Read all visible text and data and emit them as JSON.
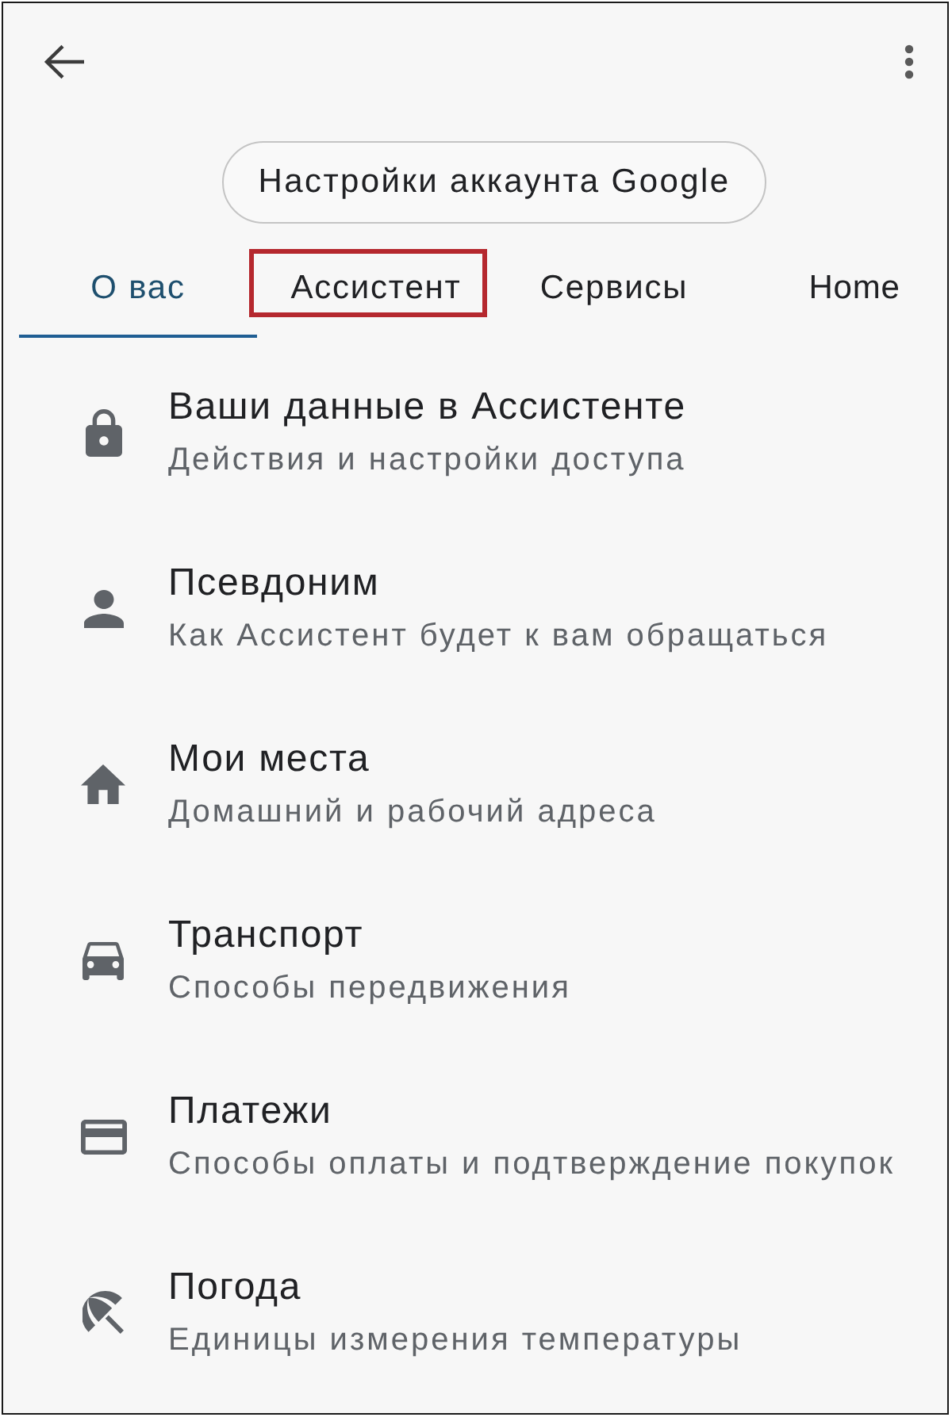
{
  "account_button": {
    "label": "Настройки аккаунта Google"
  },
  "tabs": [
    {
      "label": "О вас",
      "selected": true,
      "highlighted": false
    },
    {
      "label": "Ассистент",
      "selected": false,
      "highlighted": true
    },
    {
      "label": "Сервисы",
      "selected": false,
      "highlighted": false
    },
    {
      "label": "Home",
      "selected": false,
      "highlighted": false
    }
  ],
  "items": [
    {
      "title": "Ваши данные в Ассистенте",
      "subtitle": "Действия и настройки доступа"
    },
    {
      "title": "Псевдоним",
      "subtitle": "Как Ассистент будет к вам обращаться"
    },
    {
      "title": "Мои места",
      "subtitle": "Домашний и рабочий адреса"
    },
    {
      "title": "Транспорт",
      "subtitle": "Способы передвижения"
    },
    {
      "title": "Платежи",
      "subtitle": "Способы оплаты и подтверждение покупок"
    },
    {
      "title": "Погода",
      "subtitle": "Единицы измерения температуры"
    }
  ]
}
